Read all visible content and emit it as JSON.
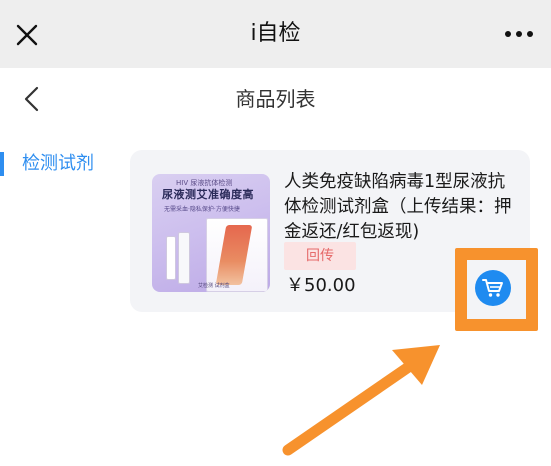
{
  "header": {
    "title": "i自检"
  },
  "subheader": {
    "title": "商品列表"
  },
  "sidebar": {
    "items": [
      {
        "label": "检测试剂",
        "active": true
      }
    ]
  },
  "product": {
    "name": "人类免疫缺陷病毒1型尿液抗体检测试剂盒（上传结果：押金返还/红包返现)",
    "tag": "回传",
    "price": "￥50.00",
    "image_text": {
      "top": "HIV 尿液抗体检测",
      "headline": "尿液测艾准确度高",
      "sub": "无需采血·隐私保护·方便快捷",
      "bottom": "艾检测 试剂盒"
    }
  },
  "colors": {
    "accent": "#2e8ef0",
    "cart": "#1f8bf0",
    "highlight": "#f7922d",
    "tag_bg": "#fbe3e3",
    "tag_text": "#e66a6a"
  },
  "icons": [
    "close-icon",
    "more-icon",
    "back-icon",
    "cart-icon",
    "annotation-arrow"
  ]
}
